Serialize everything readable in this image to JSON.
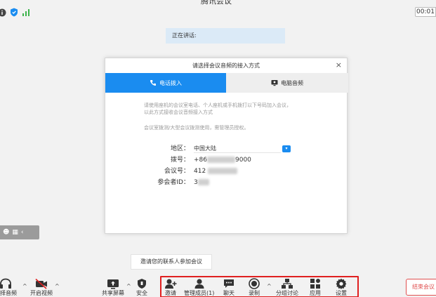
{
  "window": {
    "title": "腾讯会议"
  },
  "timer": "00:01",
  "speaking_banner": "正在讲话:",
  "dialog": {
    "title": "请选择会议音频的接入方式",
    "close": "×",
    "tabs": [
      {
        "label": "电话拨入",
        "active": true,
        "icon": "phone-icon"
      },
      {
        "label": "电脑音频",
        "active": false,
        "icon": "computer-audio-icon"
      }
    ],
    "description_line1": "请使用座机的会议室电话、个人座机或手机拨打以下号码加入会议，",
    "description_line2": "以此方式接收会议音频接入方式",
    "description_line3": "会议室拨测/大型会议拨测使用，需管理员授权。",
    "region_label": "地区：",
    "region_value": "中国大陆",
    "dial_label": "拨号：",
    "dial_value_prefix": "+86",
    "dial_value_suffix": "9000",
    "meeting_id_label": "会议号：",
    "meeting_id_value": "412",
    "participant_id_label": "参会者ID：",
    "participant_id_value": "3"
  },
  "invite_tip": "邀请您的联系人参加会议",
  "toolbar": {
    "audio_label": "选择音频",
    "video_label": "开启视频",
    "share_label": "共享屏幕",
    "security_label": "安全",
    "invite_label": "邀请",
    "members_label": "管理成员(1)",
    "chat_label": "聊天",
    "record_label": "录制",
    "breakout_label": "分组讨论",
    "apps_label": "应用",
    "settings_label": "设置",
    "end_label": "结束会议"
  },
  "colors": {
    "accent": "#1a8cf0",
    "highlight_border": "#e01f1f",
    "end": "#e05050"
  }
}
